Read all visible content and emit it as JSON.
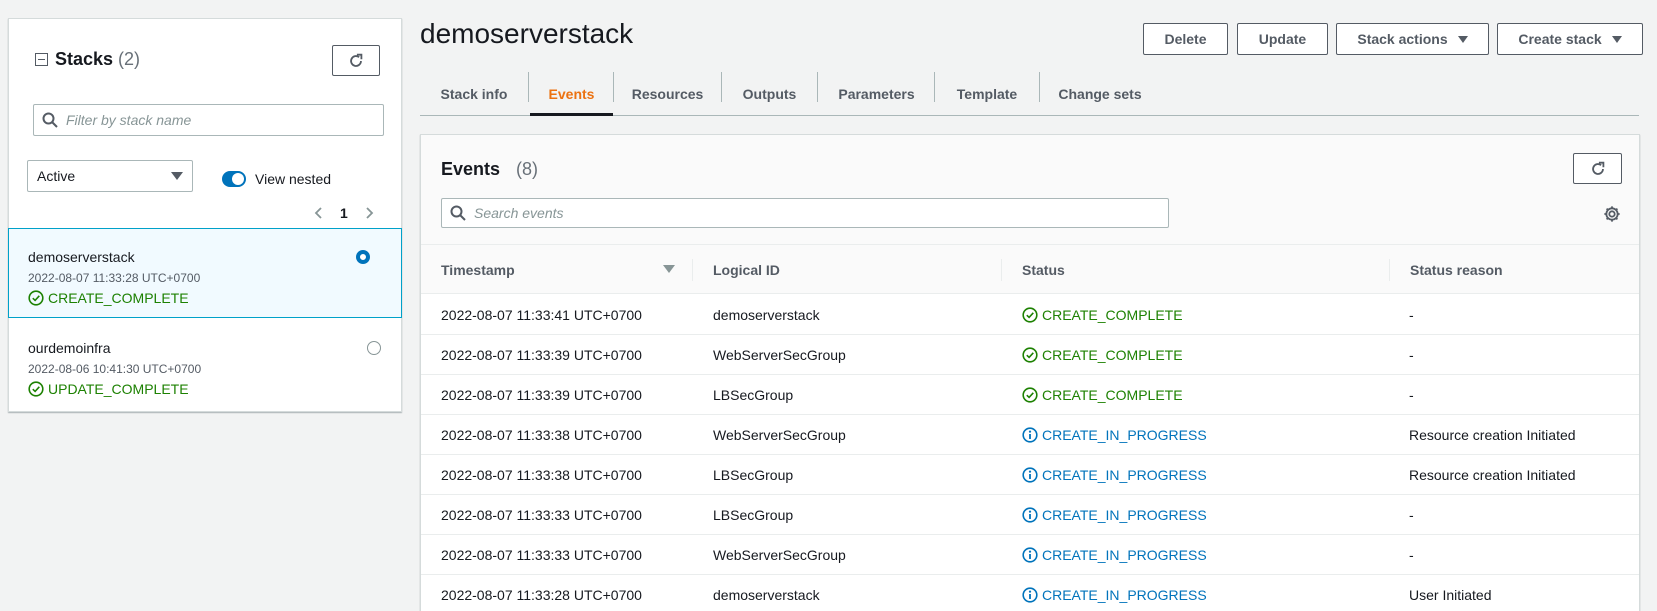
{
  "sidebar": {
    "title": "Stacks",
    "count": "(2)",
    "filter_placeholder": "Filter by stack name",
    "filter_select": "Active",
    "view_nested_label": "View nested",
    "page_number": "1",
    "stacks": [
      {
        "name": "demoserverstack",
        "time": "2022-08-07 11:33:28 UTC+0700",
        "status": "CREATE_COMPLETE",
        "selected": true
      },
      {
        "name": "ourdemoinfra",
        "time": "2022-08-06 10:41:30 UTC+0700",
        "status": "UPDATE_COMPLETE",
        "selected": false
      }
    ]
  },
  "header": {
    "title": "demoserverstack",
    "buttons": {
      "delete": "Delete",
      "update": "Update",
      "stack_actions": "Stack actions",
      "create_stack": "Create stack"
    }
  },
  "tabs": [
    "Stack info",
    "Events",
    "Resources",
    "Outputs",
    "Parameters",
    "Template",
    "Change sets"
  ],
  "active_tab": "Events",
  "events": {
    "title": "Events",
    "count": "(8)",
    "search_placeholder": "Search events",
    "columns": [
      "Timestamp",
      "Logical ID",
      "Status",
      "Status reason"
    ],
    "rows": [
      {
        "timestamp": "2022-08-07 11:33:41 UTC+0700",
        "logical_id": "demoserverstack",
        "status": "CREATE_COMPLETE",
        "reason": "-"
      },
      {
        "timestamp": "2022-08-07 11:33:39 UTC+0700",
        "logical_id": "WebServerSecGroup",
        "status": "CREATE_COMPLETE",
        "reason": "-"
      },
      {
        "timestamp": "2022-08-07 11:33:39 UTC+0700",
        "logical_id": "LBSecGroup",
        "status": "CREATE_COMPLETE",
        "reason": "-"
      },
      {
        "timestamp": "2022-08-07 11:33:38 UTC+0700",
        "logical_id": "WebServerSecGroup",
        "status": "CREATE_IN_PROGRESS",
        "reason": "Resource creation Initiated"
      },
      {
        "timestamp": "2022-08-07 11:33:38 UTC+0700",
        "logical_id": "LBSecGroup",
        "status": "CREATE_IN_PROGRESS",
        "reason": "Resource creation Initiated"
      },
      {
        "timestamp": "2022-08-07 11:33:33 UTC+0700",
        "logical_id": "LBSecGroup",
        "status": "CREATE_IN_PROGRESS",
        "reason": "-"
      },
      {
        "timestamp": "2022-08-07 11:33:33 UTC+0700",
        "logical_id": "WebServerSecGroup",
        "status": "CREATE_IN_PROGRESS",
        "reason": "-"
      },
      {
        "timestamp": "2022-08-07 11:33:28 UTC+0700",
        "logical_id": "demoserverstack",
        "status": "CREATE_IN_PROGRESS",
        "reason": "User Initiated"
      }
    ]
  },
  "colors": {
    "success": "#1d8102",
    "info": "#0073bb",
    "accent": "#ec7211"
  },
  "icons": {
    "refresh": "refresh-icon",
    "search": "search-icon",
    "settings": "gear-icon",
    "success": "check-circle-icon",
    "info": "info-circle-icon"
  }
}
